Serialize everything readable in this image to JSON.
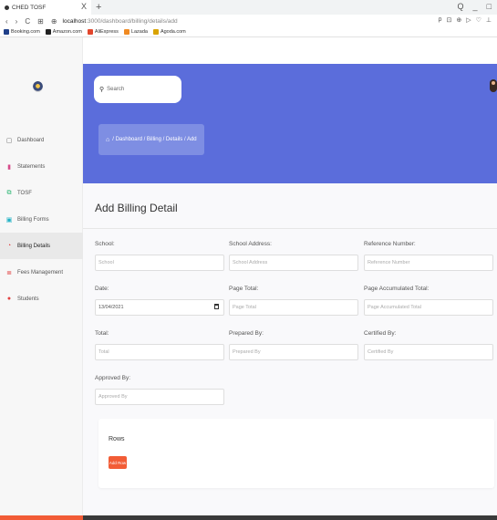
{
  "browser": {
    "tab_title": "CHED TOSF",
    "tab_close": "X",
    "new_tab": "+",
    "url_host": "localhost",
    "url_path": ":3000/dashboard/billing/details/add",
    "nav_back": "‹",
    "nav_forward": "›",
    "nav_reload": "C",
    "window_controls": [
      "Q",
      "_",
      "□"
    ],
    "url_icons": [
      "ρ",
      "⊡",
      "⊕",
      "▷",
      "♡",
      "⊥"
    ],
    "bookmarks": [
      {
        "label": "Booking.com",
        "color": "#1f3f88"
      },
      {
        "label": "Amazon.com",
        "color": "#222222"
      },
      {
        "label": "AliExpress",
        "color": "#e2462c"
      },
      {
        "label": "Lazada",
        "color": "#f08a22"
      },
      {
        "label": "Agoda.com",
        "color": "#d9a300"
      }
    ]
  },
  "sidebar": {
    "items": [
      {
        "label": "Dashboard",
        "icon": "monitor-icon",
        "glyph": "▢",
        "color": "#666666",
        "active": false
      },
      {
        "label": "Statements",
        "icon": "chart-icon",
        "glyph": "▮",
        "color": "#d64b8a",
        "active": false
      },
      {
        "label": "TOSF",
        "icon": "document-icon",
        "glyph": "⧉",
        "color": "#2bb673",
        "active": false
      },
      {
        "label": "Billing Forms",
        "icon": "cash-icon",
        "glyph": "▣",
        "color": "#1fb1c4",
        "active": false
      },
      {
        "label": "Billing Details",
        "icon": "clock-icon",
        "glyph": "◔",
        "color": "#e24141",
        "active": true
      },
      {
        "label": "Fees Management",
        "icon": "list-icon",
        "glyph": "≣",
        "color": "#e24141",
        "active": false
      },
      {
        "label": "Students",
        "icon": "user-icon",
        "glyph": "●",
        "color": "#e24141",
        "active": false
      }
    ]
  },
  "header": {
    "search_placeholder": "Search",
    "breadcrumb": "/ Dashboard / Billing / Details / Add"
  },
  "main": {
    "title": "Add Billing Detail",
    "fields": [
      {
        "label": "School:",
        "placeholder": "School",
        "value": ""
      },
      {
        "label": "School Address:",
        "placeholder": "School Address",
        "value": ""
      },
      {
        "label": "Reference Number:",
        "placeholder": "Reference Number",
        "value": ""
      },
      {
        "label": "Date:",
        "placeholder": "",
        "value": "13/04/2021"
      },
      {
        "label": "Page Total:",
        "placeholder": "Page Total",
        "value": ""
      },
      {
        "label": "Page Accumulated Total:",
        "placeholder": "Page Accumulated Total",
        "value": ""
      },
      {
        "label": "Total:",
        "placeholder": "Total",
        "value": ""
      },
      {
        "label": "Prepared By:",
        "placeholder": "Prepared By",
        "value": ""
      },
      {
        "label": "Certified By:",
        "placeholder": "Certified By",
        "value": ""
      },
      {
        "label": "Approved By:",
        "placeholder": "Approved By",
        "value": ""
      }
    ],
    "rows": {
      "title": "Rows",
      "add_button": "Add Row"
    }
  }
}
